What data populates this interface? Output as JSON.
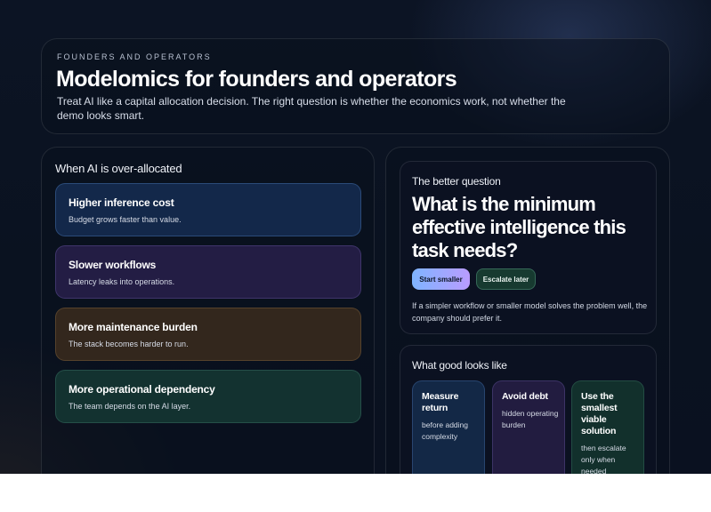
{
  "header": {
    "eyebrow": "FOUNDERS AND OPERATORS",
    "title": "Modelomics for founders and operators",
    "subtitle": "Treat AI like a capital allocation decision. The right question is whether the economics work, not whether the demo looks smart."
  },
  "over_allocated": {
    "heading": "When AI is over-allocated",
    "items": [
      {
        "title": "Higher inference cost",
        "desc": "Budget grows faster than value."
      },
      {
        "title": "Slower workflows",
        "desc": "Latency leaks into operations."
      },
      {
        "title": "More maintenance burden",
        "desc": "The stack becomes harder to run."
      },
      {
        "title": "More operational dependency",
        "desc": "The team depends on the AI layer."
      }
    ]
  },
  "better_question": {
    "eyebrow": "The better question",
    "title": "What is the minimum effective intelligence this task needs?",
    "primary_button": "Start smaller",
    "secondary_button": "Escalate later",
    "body": "If a simpler workflow or smaller model solves the problem well, the company should prefer it."
  },
  "good_looks_like": {
    "heading": "What good looks like",
    "cards": [
      {
        "title": "Measure return",
        "desc": "before adding complexity"
      },
      {
        "title": "Avoid debt",
        "desc": "hidden operating burden"
      },
      {
        "title": "Use the smallest viable solution",
        "desc": "then escalate only when needed"
      }
    ]
  },
  "colors": {
    "background": "#0a1220",
    "accent_gradient_start": "#7fb4ff",
    "accent_gradient_end": "#b99cff",
    "blue_card": "#13284a",
    "purple_card": "#231d44",
    "brown_card": "#33271d",
    "green_card": "#133230"
  }
}
